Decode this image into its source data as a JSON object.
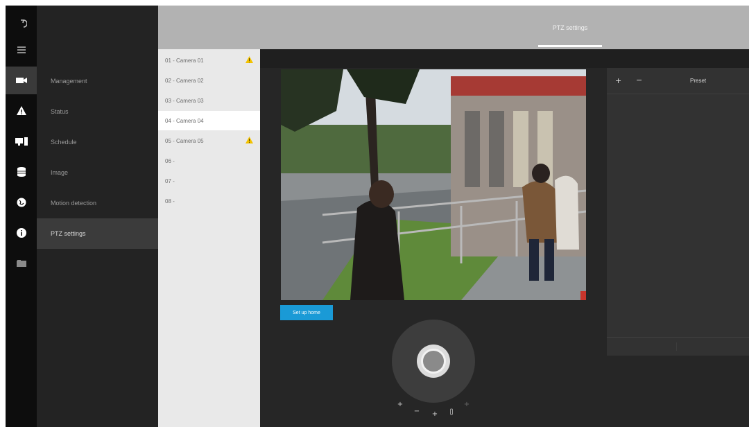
{
  "rail": {
    "items": [
      {
        "icon": "back-arrow-icon",
        "active": false
      },
      {
        "icon": "list-icon",
        "active": false
      },
      {
        "icon": "camera-icon",
        "active": true
      },
      {
        "icon": "alert-icon",
        "active": false
      },
      {
        "icon": "display-icon",
        "active": false
      },
      {
        "icon": "storage-icon",
        "active": false
      },
      {
        "icon": "globe-icon",
        "active": false
      },
      {
        "icon": "info-icon",
        "active": false
      },
      {
        "icon": "folder-icon",
        "active": false
      }
    ]
  },
  "subnav": {
    "items": [
      {
        "label": "Management",
        "active": false
      },
      {
        "label": "Status",
        "active": false
      },
      {
        "label": "Schedule",
        "active": false
      },
      {
        "label": "Image",
        "active": false
      },
      {
        "label": "Motion detection",
        "active": false
      },
      {
        "label": "PTZ settings",
        "active": true
      }
    ]
  },
  "topbar": {
    "tab_label": "PTZ settings"
  },
  "cameras": {
    "items": [
      {
        "label": "01 - Camera 01",
        "warning": true,
        "active": false
      },
      {
        "label": "02 - Camera 02",
        "warning": false,
        "active": false
      },
      {
        "label": "03 - Camera 03",
        "warning": false,
        "active": false
      },
      {
        "label": "04 - Camera 04",
        "warning": false,
        "active": true
      },
      {
        "label": "05 - Camera 05",
        "warning": true,
        "active": false
      },
      {
        "label": "06 -",
        "warning": false,
        "active": false
      },
      {
        "label": "07 -",
        "warning": false,
        "active": false
      },
      {
        "label": "08 -",
        "warning": false,
        "active": false
      }
    ]
  },
  "video": {
    "setup_button_label": "Set up home"
  },
  "controls": {
    "zoom_in": "+",
    "zoom_out": "−",
    "focus": "+",
    "plus": "+"
  },
  "preset": {
    "title": "Preset",
    "add_label": "+",
    "remove_label": "−"
  },
  "colors": {
    "accent": "#1a9ad6",
    "warning": "#f2c200"
  }
}
